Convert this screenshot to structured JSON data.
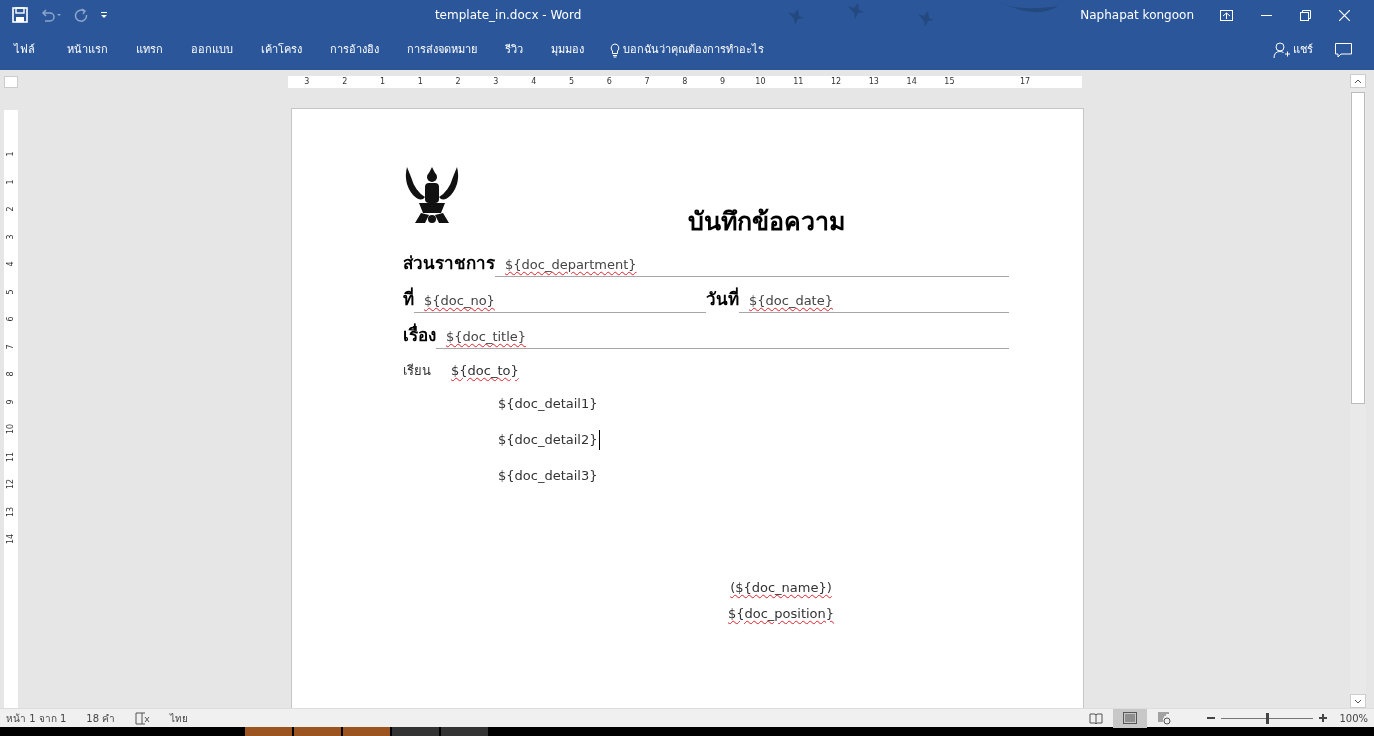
{
  "window": {
    "title": "template_in.docx  -  Word",
    "user": "Naphapat kongoon"
  },
  "ribbon_tabs": [
    {
      "label": "ไฟล์"
    },
    {
      "label": "หน้าแรก"
    },
    {
      "label": "แทรก"
    },
    {
      "label": "ออกแบบ"
    },
    {
      "label": "เค้าโครง"
    },
    {
      "label": "การอ้างอิง"
    },
    {
      "label": "การส่งจดหมาย"
    },
    {
      "label": "รีวิว"
    },
    {
      "label": "มุมมอง"
    }
  ],
  "tell_me": "บอกฉันว่าคุณต้องการทำอะไร",
  "share": "แชร์",
  "ruler": {
    "horizontal": [
      "3",
      "2",
      "1",
      "1",
      "2",
      "3",
      "4",
      "5",
      "6",
      "7",
      "8",
      "9",
      "10",
      "11",
      "12",
      "13",
      "14",
      "15",
      "17"
    ],
    "vertical": [
      "1",
      "1",
      "2",
      "3",
      "4",
      "5",
      "6",
      "7",
      "8",
      "9",
      "10",
      "11",
      "12",
      "13",
      "14"
    ]
  },
  "document": {
    "heading": "บันทึกข้อความ",
    "field_rows": [
      [
        {
          "label": "ส่วนราชการ",
          "value": "${doc_department}",
          "spelling_error": true
        }
      ],
      [
        {
          "label": "ที่",
          "value": "${doc_no}",
          "spelling_error": true
        },
        {
          "label": "วันที่",
          "value": "${doc_date}",
          "spelling_error": true
        }
      ],
      [
        {
          "label": "เรื่อง",
          "value": "${doc_title}",
          "spelling_error": true
        }
      ]
    ],
    "salutation": {
      "label": "เรียน",
      "value": "${doc_to}",
      "spelling_error": true
    },
    "details": [
      {
        "text": "${doc_detail1}",
        "cursor": false
      },
      {
        "text": "${doc_detail2}",
        "cursor": true
      },
      {
        "text": "${doc_detail3}",
        "cursor": false
      }
    ],
    "signature": [
      {
        "text": "(${doc_name})",
        "spelling_error": true
      },
      {
        "text": "${doc_position}",
        "spelling_error": true
      }
    ]
  },
  "status_bar": {
    "page": "หน้า 1 จาก 1",
    "words": "18 คำ",
    "language": "ไทย",
    "views": [
      {
        "kind": "read",
        "selected": false
      },
      {
        "kind": "print",
        "selected": true
      },
      {
        "kind": "web",
        "selected": false
      }
    ],
    "zoom": {
      "level": 0.5,
      "reading": "100%"
    }
  }
}
